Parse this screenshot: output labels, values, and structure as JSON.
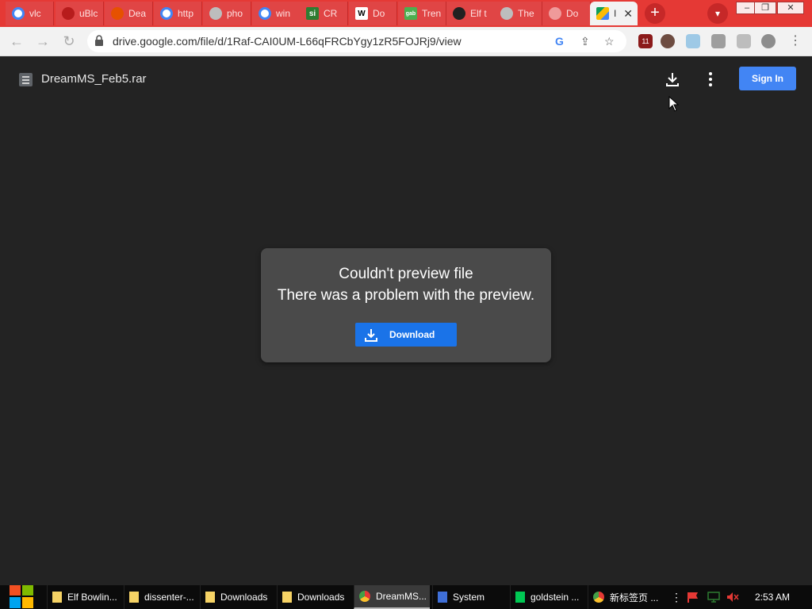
{
  "browser": {
    "tabs": [
      {
        "label": "vlc",
        "favicon": "google-g-icon",
        "color": "#ffffff"
      },
      {
        "label": "uBlc",
        "favicon": "ublock-icon",
        "color": "#b71c1c"
      },
      {
        "label": "Dea",
        "favicon": "dealabs-icon",
        "color": "#e65100"
      },
      {
        "label": "http",
        "favicon": "google-g-icon",
        "color": "#ffffff"
      },
      {
        "label": "pho",
        "favicon": "globe-icon",
        "color": "#bdbdbd"
      },
      {
        "label": "win",
        "favicon": "google-g-icon",
        "color": "#ffffff"
      },
      {
        "label": "CR",
        "favicon": "si-icon",
        "color": "#2e7d32",
        "text": "si"
      },
      {
        "label": "Do",
        "favicon": "wikipedia-icon",
        "color": "#ffffff",
        "text": "W"
      },
      {
        "label": "Tren",
        "favicon": "tab-icon",
        "color": "#4caf50",
        "text": "gab"
      },
      {
        "label": "Elf t",
        "favicon": "museum-icon",
        "color": "#212121"
      },
      {
        "label": "The",
        "favicon": "globe-icon",
        "color": "#bdbdbd"
      },
      {
        "label": "Do",
        "favicon": "download-icon",
        "color": "#ef9a9a"
      },
      {
        "label": "I",
        "favicon": "google-drive-icon",
        "color": "#fbbc04",
        "active": true
      }
    ],
    "url": "drive.google.com/file/d/1Raf-CAI0UM-L66qFRCbYgy1zR5FOJRj9/view",
    "extension_badge": "11"
  },
  "drive": {
    "file_name": "DreamMS_Feb5.rar",
    "sign_in_label": "Sign In",
    "error_title": "Couldn't preview file",
    "error_message": "There was a problem with the preview.",
    "download_label": "Download"
  },
  "taskbar": {
    "items": [
      {
        "label": "Elf Bowlin...",
        "icon": "folder-icon"
      },
      {
        "label": "dissenter-...",
        "icon": "folder-icon"
      },
      {
        "label": "Downloads",
        "icon": "folder-icon"
      },
      {
        "label": "Downloads",
        "icon": "folder-icon"
      },
      {
        "label": "DreamMS...",
        "icon": "chrome-icon",
        "active": true
      },
      {
        "label": "System",
        "icon": "system-icon"
      },
      {
        "label": "goldstein ...",
        "icon": "notes-icon"
      },
      {
        "label": "新标签页 ...",
        "icon": "chrome-icon"
      }
    ],
    "clock": "2:53 AM"
  },
  "colors": {
    "tab_strip": "#e53935",
    "page_bg": "#232323",
    "card_bg": "#4a4a4a",
    "primary_button": "#1a73e8",
    "sign_in": "#4285f4"
  }
}
